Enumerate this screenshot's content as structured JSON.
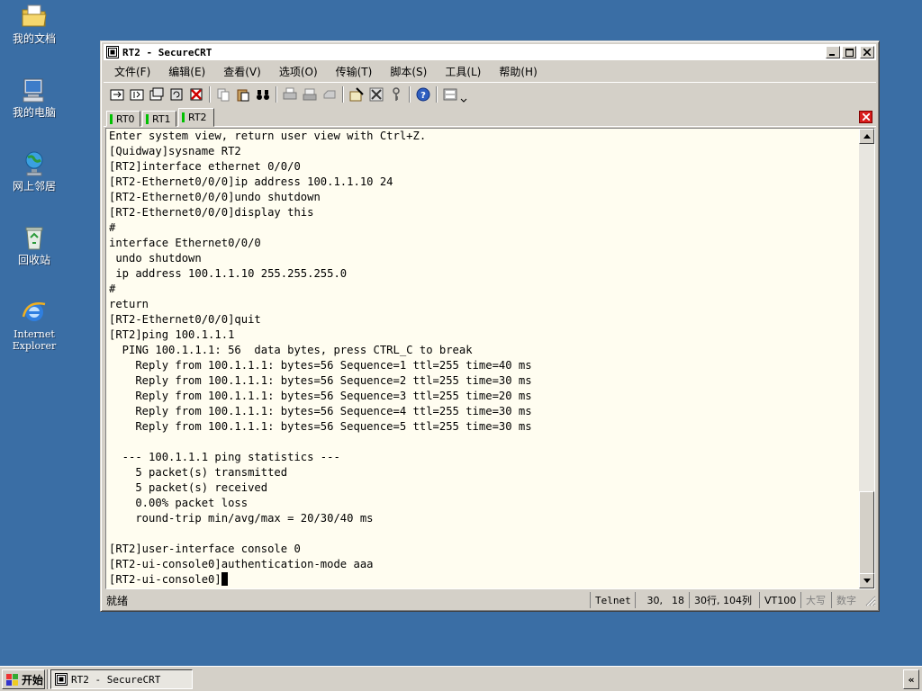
{
  "desktop": {
    "icons": [
      {
        "label": "我的文档",
        "icon": "my-documents-icon"
      },
      {
        "label": "我的电脑",
        "icon": "my-computer-icon"
      },
      {
        "label": "网上邻居",
        "icon": "network-places-icon"
      },
      {
        "label": "回收站",
        "icon": "recycle-bin-icon"
      },
      {
        "label": "Internet\nExplorer",
        "icon": "internet-explorer-icon"
      }
    ]
  },
  "window": {
    "title": "RT2 - SecureCRT",
    "menu": [
      "文件(F)",
      "编辑(E)",
      "查看(V)",
      "选项(O)",
      "传输(T)",
      "脚本(S)",
      "工具(L)",
      "帮助(H)"
    ],
    "tabs": [
      {
        "label": "RT0",
        "active": false
      },
      {
        "label": "RT1",
        "active": false
      },
      {
        "label": "RT2",
        "active": true
      }
    ]
  },
  "terminal": {
    "lines": [
      "Enter system view, return user view with Ctrl+Z.",
      "[Quidway]sysname RT2",
      "[RT2]interface ethernet 0/0/0",
      "[RT2-Ethernet0/0/0]ip address 100.1.1.10 24",
      "[RT2-Ethernet0/0/0]undo shutdown",
      "[RT2-Ethernet0/0/0]display this",
      "#",
      "interface Ethernet0/0/0",
      " undo shutdown",
      " ip address 100.1.1.10 255.255.255.0",
      "#",
      "return",
      "[RT2-Ethernet0/0/0]quit",
      "[RT2]ping 100.1.1.1",
      "  PING 100.1.1.1: 56  data bytes, press CTRL_C to break",
      "    Reply from 100.1.1.1: bytes=56 Sequence=1 ttl=255 time=40 ms",
      "    Reply from 100.1.1.1: bytes=56 Sequence=2 ttl=255 time=30 ms",
      "    Reply from 100.1.1.1: bytes=56 Sequence=3 ttl=255 time=20 ms",
      "    Reply from 100.1.1.1: bytes=56 Sequence=4 ttl=255 time=30 ms",
      "    Reply from 100.1.1.1: bytes=56 Sequence=5 ttl=255 time=30 ms",
      "",
      "  --- 100.1.1.1 ping statistics ---",
      "    5 packet(s) transmitted",
      "    5 packet(s) received",
      "    0.00% packet loss",
      "    round-trip min/avg/max = 20/30/40 ms",
      "",
      "[RT2]user-interface console 0",
      "[RT2-ui-console0]authentication-mode aaa",
      "[RT2-ui-console0]"
    ]
  },
  "statusbar": {
    "ready": "就绪",
    "protocol": "Telnet",
    "row": "30,",
    "col": "18",
    "dims": "30行, 104列",
    "emulation": "VT100",
    "caps": "大写",
    "num": "数字"
  },
  "taskbar": {
    "start_label": "开始",
    "task_label": "RT2 - SecureCRT",
    "tray_label": "«"
  },
  "colors": {
    "desktop": "#3a6ea5",
    "terminal_bg": "#fffdf0",
    "tab_indicator": "#00c000",
    "tab_close": "#d91d1d"
  }
}
